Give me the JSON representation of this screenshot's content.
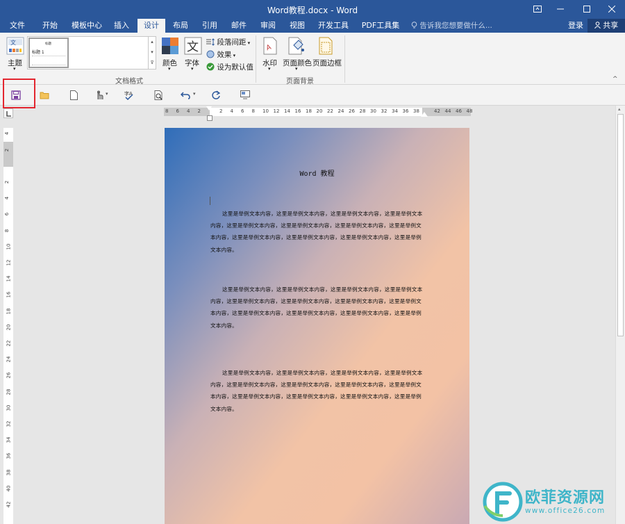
{
  "window": {
    "title": "Word教程.docx - Word"
  },
  "tabs": [
    "文件",
    "开始",
    "模板中心",
    "插入",
    "设计",
    "布局",
    "引用",
    "邮件",
    "审阅",
    "视图",
    "开发工具",
    "PDF工具集"
  ],
  "tell_me": "告诉我您想要做什么...",
  "account": {
    "login": "登录",
    "share": "共享"
  },
  "ribbon": {
    "theme_label": "主题",
    "style_preview_title": "标题",
    "style_preview_heading": "标题 1",
    "colors_label": "颜色",
    "fonts_label": "字体",
    "paragraph_spacing": "段落间距",
    "effects": "效果",
    "set_default": "设为默认值",
    "group_doc_format": "文档格式",
    "watermark": "水印",
    "page_color": "页面颜色",
    "page_border": "页面边框",
    "group_page_bg": "页面背景"
  },
  "ruler": {
    "h_left_ticks": [
      "8",
      "6",
      "4",
      "2"
    ],
    "h_ticks": [
      "2",
      "4",
      "6",
      "8",
      "10",
      "12",
      "14",
      "16",
      "18",
      "20",
      "22",
      "24",
      "26",
      "28",
      "30",
      "32",
      "34",
      "36",
      "38"
    ],
    "h_right_ticks": [
      "42",
      "44",
      "46",
      "48"
    ],
    "v_top_ticks": [
      "4",
      "2"
    ],
    "v_ticks": [
      "2",
      "4",
      "6",
      "8",
      "10",
      "12",
      "14",
      "16",
      "18",
      "20",
      "22",
      "24",
      "26",
      "28",
      "30",
      "32",
      "34",
      "36",
      "38",
      "40",
      "42"
    ]
  },
  "document": {
    "title": "Word 教程",
    "paragraphs": [
      "这里是举例文本内容，这里是举例文本内容，这里是举例文本内容，这里是举例文本内容，这里是举例文本内容，这里是举例文本内容，这里是举例文本内容，这里是举例文本内容，这里是举例文本内容，这里是举例文本内容，这里是举例文本内容，这里是举例文本内容。",
      "这里是举例文本内容，这里是举例文本内容，这里是举例文本内容，这里是举例文本内容，这里是举例文本内容，这里是举例文本内容，这里是举例文本内容，这里是举例文本内容，这里是举例文本内容，这里是举例文本内容，这里是举例文本内容，这里是举例文本内容。",
      "这里是举例文本内容，这里是举例文本内容，这里是举例文本内容，这里是举例文本内容，这里是举例文本内容，这里是举例文本内容，这里是举例文本内容，这里是举例文本内容，这里是举例文本内容，这里是举例文本内容，这里是举例文本内容，这里是举例文本内容。"
    ]
  },
  "watermark": {
    "text": "欧菲资源网",
    "url": "www.office26.com"
  },
  "colors": {
    "titlebar": "#2b579a",
    "highlight": "#e3262f",
    "watermark": "#3fb5c9"
  }
}
